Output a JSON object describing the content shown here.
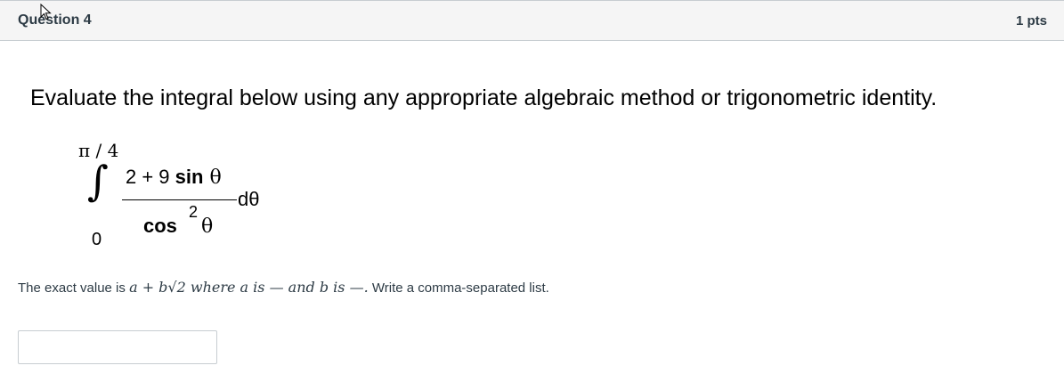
{
  "question": {
    "title": "Question 4",
    "points": "1 pts",
    "prompt": "Evaluate the integral below using any appropriate algebraic method or trigonometric identity."
  },
  "integral": {
    "upper_limit": "π / 4",
    "lower_limit": "0",
    "integral_sign": "∫",
    "numerator_prefix": "2 + 9 ",
    "numerator_func": "sin",
    "numerator_var": " θ",
    "denominator_func": "cos",
    "denominator_exponent": "2",
    "denominator_var": "θ",
    "differential": "dθ"
  },
  "answer": {
    "lead_text": "The exact value is ",
    "math_expression": "a + b√2 where a is  —  and b is —.",
    "tail_text": " Write a comma-separated list.",
    "input_value": "",
    "input_placeholder": ""
  }
}
